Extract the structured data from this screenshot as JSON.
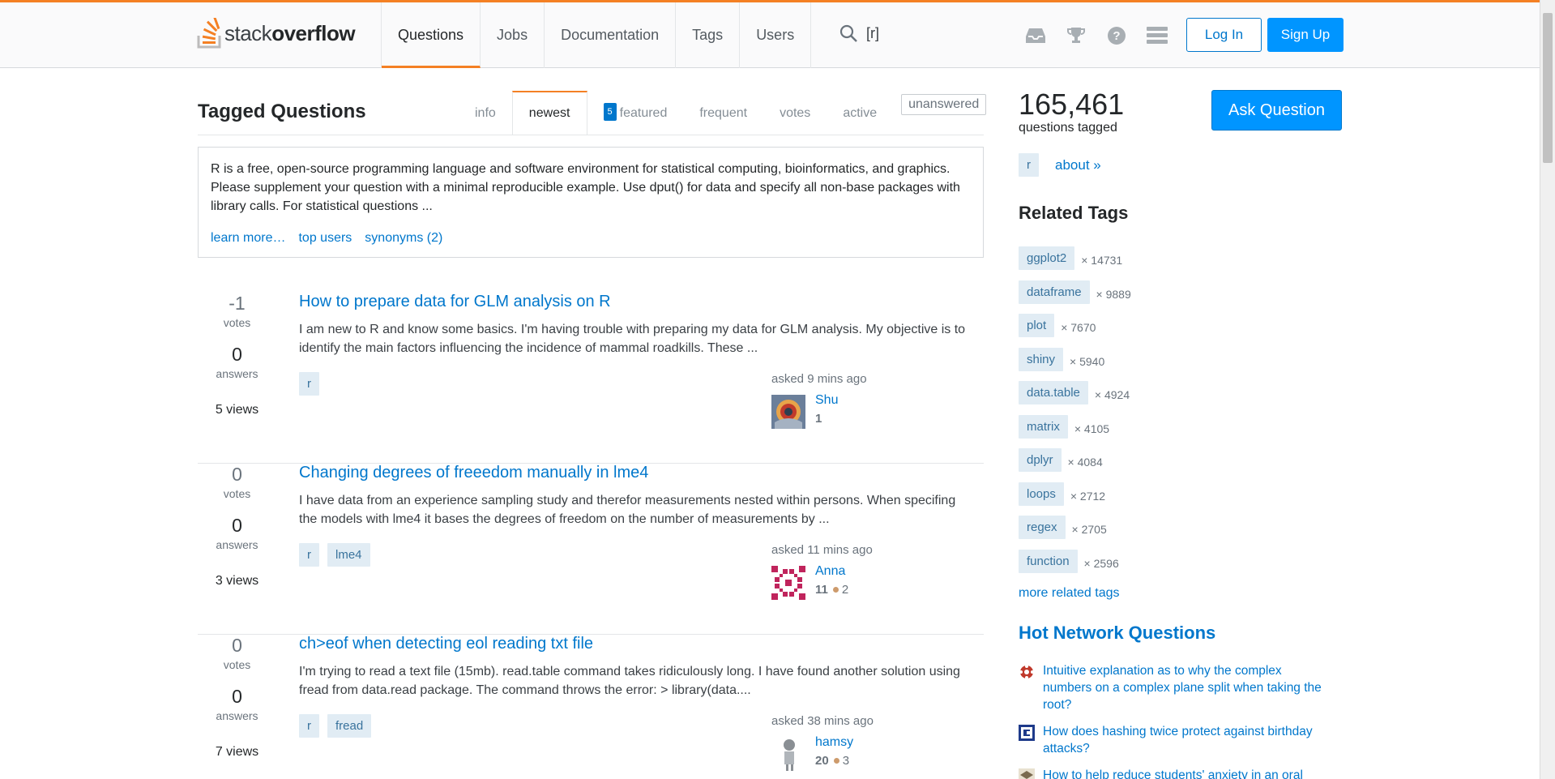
{
  "header": {
    "logo": {
      "part1": "stack",
      "part2": "overflow"
    },
    "nav": [
      {
        "label": "Questions",
        "active": true
      },
      {
        "label": "Jobs"
      },
      {
        "label": "Documentation"
      },
      {
        "label": "Tags"
      },
      {
        "label": "Users"
      }
    ],
    "search_query": "[r]",
    "icons": [
      "inbox-icon",
      "trophy-icon",
      "help-icon",
      "menu-icon"
    ],
    "login_label": "Log In",
    "signup_label": "Sign Up"
  },
  "main": {
    "title": "Tagged Questions",
    "tabs": {
      "info": "info",
      "newest": "newest",
      "featured_badge": "5",
      "featured": "featured",
      "frequent": "frequent",
      "votes": "votes",
      "active": "active",
      "unanswered": "unanswered"
    },
    "wiki": {
      "excerpt": "R is a free, open-source programming language and software environment for statistical computing, bioinformatics, and graphics. Please supplement your question with a minimal reproducible example. Use dput() for data and specify all non-base packages with library calls. For statistical questions ...",
      "links": [
        "learn more…",
        "top users",
        "synonyms (2)"
      ]
    },
    "questions": [
      {
        "votes": "-1",
        "votes_label": "votes",
        "answers": "0",
        "answers_label": "answers",
        "views": "5 views",
        "title": "How to prepare data for GLM analysis on R",
        "excerpt": "I am new to R and know some basics. I'm having trouble with preparing my data for GLM analysis. My objective is to identify the main factors influencing the incidence of mammal roadkills. These ...",
        "tags": [
          "r"
        ],
        "asked": "asked 9 mins ago",
        "user": "Shu",
        "rep": "1",
        "bronze": ""
      },
      {
        "votes": "0",
        "votes_label": "votes",
        "answers": "0",
        "answers_label": "answers",
        "views": "3 views",
        "title": "Changing degrees of freeedom manually in lme4",
        "excerpt": "I have data from an experience sampling study and therefor measurements nested within persons. When specifing the models with lme4 it bases the degrees of freedom on the number of measurements by ...",
        "tags": [
          "r",
          "lme4"
        ],
        "asked": "asked 11 mins ago",
        "user": "Anna",
        "rep": "11",
        "bronze": "2"
      },
      {
        "votes": "0",
        "votes_label": "votes",
        "answers": "0",
        "answers_label": "answers",
        "views": "7 views",
        "title": "ch>eof when detecting eol reading txt file",
        "excerpt": "I'm trying to read a text file (15mb). read.table command takes ridiculously long. I have found another solution using fread from data.read package. The command throws the error: > library(data....",
        "tags": [
          "r",
          "fread"
        ],
        "asked": "asked 38 mins ago",
        "user": "hamsy",
        "rep": "20",
        "bronze": "3"
      }
    ]
  },
  "sidebar": {
    "count": "165,461",
    "count_label": "questions tagged",
    "ask_label": "Ask Question",
    "current_tag": "r",
    "about": "about »",
    "related_title": "Related Tags",
    "related": [
      {
        "tag": "ggplot2",
        "count": "× 14731"
      },
      {
        "tag": "dataframe",
        "count": "× 9889"
      },
      {
        "tag": "plot",
        "count": "× 7670"
      },
      {
        "tag": "shiny",
        "count": "× 5940"
      },
      {
        "tag": "data.table",
        "count": "× 4924"
      },
      {
        "tag": "matrix",
        "count": "× 4105"
      },
      {
        "tag": "dplyr",
        "count": "× 4084"
      },
      {
        "tag": "loops",
        "count": "× 2712"
      },
      {
        "tag": "regex",
        "count": "× 2705"
      },
      {
        "tag": "function",
        "count": "× 2596"
      }
    ],
    "more_related": "more related tags",
    "hot_title": "Hot Network Questions",
    "hot": [
      {
        "text": "Intuitive explanation as to why the complex numbers on a complex plane split when taking the root?",
        "icon": "math-site-icon"
      },
      {
        "text": "How does hashing twice protect against birthday attacks?",
        "icon": "crypto-site-icon"
      },
      {
        "text": "How to help reduce students' anxiety in an oral",
        "icon": "academia-site-icon"
      }
    ]
  },
  "colors": {
    "accent": "#f48024",
    "link": "#0077cc",
    "button": "#0095ff",
    "tag_bg": "#e1ecf4",
    "tag_fg": "#39739d"
  }
}
